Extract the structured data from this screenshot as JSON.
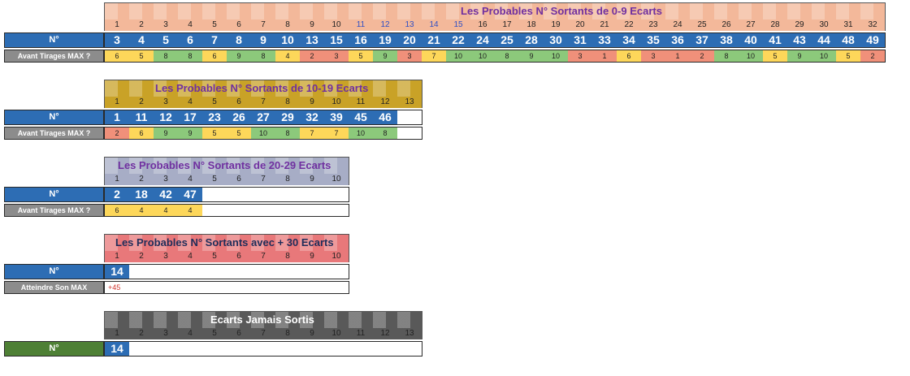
{
  "sections": [
    {
      "id": "s1",
      "title": "Les Probables N° Sortants de 0-9 Ecarts",
      "title_color": "#7030a0",
      "header_bg": "#f3b89a",
      "n_label": "N°",
      "second_label": "Avant Tirages MAX ?",
      "columns": [
        "1",
        "2",
        "3",
        "4",
        "5",
        "6",
        "7",
        "8",
        "9",
        "10",
        "11",
        "12",
        "13",
        "14",
        "15",
        "16",
        "17",
        "18",
        "19",
        "20",
        "21",
        "22",
        "23",
        "24",
        "25",
        "26",
        "27",
        "28",
        "29",
        "30",
        "31",
        "32"
      ],
      "blue_columns": [
        "11",
        "12",
        "13",
        "14",
        "15"
      ],
      "numbers": [
        "3",
        "4",
        "5",
        "6",
        "7",
        "8",
        "9",
        "10",
        "13",
        "15",
        "16",
        "19",
        "20",
        "21",
        "22",
        "24",
        "25",
        "28",
        "30",
        "31",
        "33",
        "34",
        "35",
        "36",
        "37",
        "38",
        "40",
        "41",
        "43",
        "44",
        "48",
        "49"
      ],
      "values": [
        "6",
        "5",
        "8",
        "8",
        "6",
        "9",
        "8",
        "4",
        "2",
        "3",
        "5",
        "9",
        "3",
        "7",
        "10",
        "10",
        "8",
        "9",
        "10",
        "3",
        "1",
        "6",
        "3",
        "1",
        "2",
        "8",
        "10",
        "5",
        "9",
        "10",
        "5",
        "2"
      ],
      "value_colors": [
        "yel",
        "yel",
        "grn",
        "grn",
        "yel",
        "grn",
        "grn",
        "yel",
        "red",
        "red",
        "yel",
        "grn",
        "red",
        "yel",
        "grn",
        "grn",
        "grn",
        "grn",
        "grn",
        "red",
        "red",
        "yel",
        "red",
        "red",
        "red",
        "grn",
        "grn",
        "yel",
        "grn",
        "grn",
        "yel",
        "red"
      ]
    },
    {
      "id": "s2",
      "title": "Les Probables N° Sortants de 10-19 Ecarts",
      "title_color": "#7030a0",
      "header_bg": "#c9a227",
      "n_label": "N°",
      "second_label": "Avant Tirages MAX ?",
      "columns": [
        "1",
        "2",
        "3",
        "4",
        "5",
        "6",
        "7",
        "8",
        "9",
        "10",
        "11",
        "12",
        "13"
      ],
      "numbers": [
        "1",
        "11",
        "12",
        "17",
        "23",
        "26",
        "27",
        "29",
        "32",
        "39",
        "45",
        "46"
      ],
      "values": [
        "2",
        "6",
        "9",
        "9",
        "5",
        "5",
        "10",
        "8",
        "7",
        "7",
        "10",
        "8"
      ],
      "value_colors": [
        "red",
        "yel",
        "grn",
        "grn",
        "yel",
        "yel",
        "grn",
        "grn",
        "yel",
        "yel",
        "grn",
        "grn"
      ]
    },
    {
      "id": "s3",
      "title": "Les Probables N° Sortants de 20-29 Ecarts",
      "title_color": "#7030a0",
      "header_bg": "#a7adc6",
      "n_label": "N°",
      "second_label": "Avant Tirages MAX ?",
      "columns": [
        "1",
        "2",
        "3",
        "4",
        "5",
        "6",
        "7",
        "8",
        "9",
        "10"
      ],
      "numbers": [
        "2",
        "18",
        "42",
        "47"
      ],
      "values": [
        "6",
        "4",
        "4",
        "4"
      ],
      "value_colors": [
        "yel",
        "yel",
        "yel",
        "yel"
      ]
    },
    {
      "id": "s4",
      "title": "Les Probables N° Sortants avec + 30 Ecarts",
      "title_color": "#1f2d5a",
      "header_bg": "#e8787a",
      "n_label": "N°",
      "second_label": "Atteindre Son MAX",
      "columns": [
        "1",
        "2",
        "3",
        "4",
        "5",
        "6",
        "7",
        "8",
        "9",
        "10"
      ],
      "numbers": [
        "14"
      ],
      "values": [
        "+45"
      ],
      "value_colors": [
        "plus"
      ]
    },
    {
      "id": "s5",
      "title": "Ecarts Jamais Sortis",
      "title_color": "#ffffff",
      "header_bg": "#595959",
      "n_label": "N°",
      "columns": [
        "1",
        "2",
        "3",
        "4",
        "5",
        "6",
        "7",
        "8",
        "9",
        "10",
        "11",
        "12",
        "13"
      ],
      "numbers": [
        "14"
      ]
    }
  ]
}
